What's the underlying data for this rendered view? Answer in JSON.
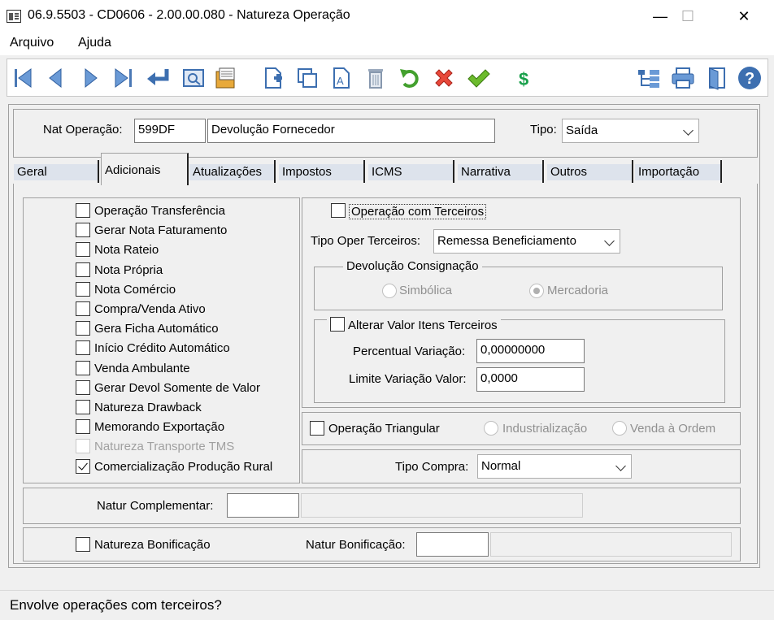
{
  "window": {
    "title": "06.9.5503 - CD0606 - 2.00.00.080 - Natureza Operação",
    "minimize": "—",
    "maximize": "☐",
    "close": "✕"
  },
  "menu": {
    "items": [
      "Arquivo",
      "Ajuda"
    ]
  },
  "toolbar": {
    "icons": [
      "first-icon",
      "prev-icon",
      "next-icon",
      "last-icon",
      "enter-icon",
      "preview-icon",
      "catalog-icon",
      "new-icon",
      "copy-icon",
      "text-icon",
      "delete-icon",
      "undo-icon",
      "cancel-icon",
      "confirm-icon",
      "money-icon",
      "tree-icon",
      "print-icon",
      "exit-icon",
      "help-icon"
    ],
    "money_glyph": "$",
    "help_glyph": "?",
    "text_glyph": "A"
  },
  "header": {
    "nat_label": "Nat Operação:",
    "nat_code": "599DF",
    "nat_desc": "Devolução Fornecedor",
    "tipo_label": "Tipo:",
    "tipo_value": "Saída"
  },
  "tabs": [
    "Geral",
    "Adicionais",
    "Atualizações",
    "Impostos",
    "ICMS",
    "Narrativa",
    "Outros",
    "Importação"
  ],
  "active_tab": "Adicionais",
  "left_checks": [
    {
      "label": "Operação Transferência",
      "checked": false,
      "disabled": false
    },
    {
      "label": "Gerar Nota Faturamento",
      "checked": false,
      "disabled": false
    },
    {
      "label": "Nota Rateio",
      "checked": false,
      "disabled": false
    },
    {
      "label": "Nota Própria",
      "checked": false,
      "disabled": false
    },
    {
      "label": "Nota Comércio",
      "checked": false,
      "disabled": false
    },
    {
      "label": "Compra/Venda Ativo",
      "checked": false,
      "disabled": false
    },
    {
      "label": "Gera Ficha Automático",
      "checked": false,
      "disabled": false
    },
    {
      "label": "Início Crédito Automático",
      "checked": false,
      "disabled": false
    },
    {
      "label": "Venda Ambulante",
      "checked": false,
      "disabled": false
    },
    {
      "label": "Gerar Devol Somente de Valor",
      "checked": false,
      "disabled": false
    },
    {
      "label": "Natureza Drawback",
      "checked": false,
      "disabled": false
    },
    {
      "label": "Memorando Exportação",
      "checked": false,
      "disabled": false
    },
    {
      "label": "Natureza Transporte TMS",
      "checked": false,
      "disabled": true
    },
    {
      "label": "Comercialização Produção Rural",
      "checked": true,
      "disabled": false
    }
  ],
  "terceiros": {
    "op_label": "Operação com Terceiros",
    "tipo_label": "Tipo Oper Terceiros:",
    "tipo_value": "Remessa Beneficiamento",
    "devol_legend": "Devolução Consignação",
    "radio_simbolica": "Simbólica",
    "radio_mercadoria": "Mercadoria",
    "alterar_label": "Alterar Valor Itens Terceiros",
    "perc_label": "Percentual Variação:",
    "perc_value": "0,00000000",
    "limite_label": "Limite Variação Valor:",
    "limite_value": "0,0000"
  },
  "triangular": {
    "label": "Operação Triangular",
    "radio_ind": "Industrialização",
    "radio_venda": "Venda à Ordem"
  },
  "compra": {
    "label": "Tipo Compra:",
    "value": "Normal"
  },
  "complementar": {
    "label": "Natur Complementar:",
    "value": ""
  },
  "bonificacao": {
    "check_label": "Natureza Bonificação",
    "label": "Natur Bonificação:",
    "value": ""
  },
  "status": {
    "text": "Envolve operações com terceiros?"
  }
}
